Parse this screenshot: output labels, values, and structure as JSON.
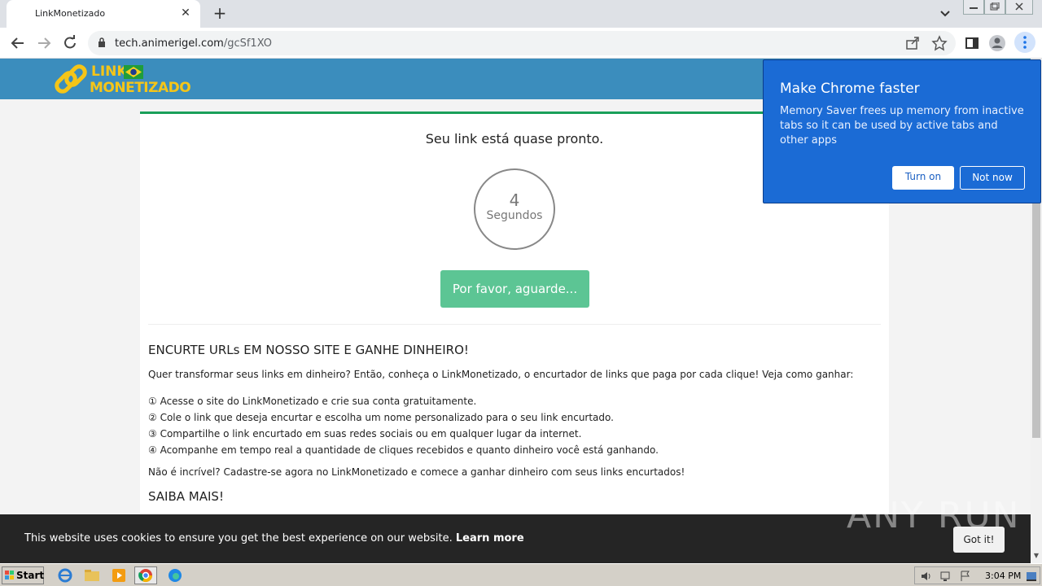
{
  "browser": {
    "tab_title": "LinkMonetizado",
    "url_host": "tech.animerigel.com",
    "url_path": "/gcSf1XO"
  },
  "site": {
    "logo_line1": "LINK",
    "logo_line2": "MONETIZADO",
    "ready_text": "Seu link está quase pronto.",
    "countdown_value": "4",
    "countdown_label": "Segundos",
    "wait_button": "Por favor, aguarde...",
    "heading_earn": "ENCURTE URLs EM NOSSO SITE E GANHE DINHEIRO!",
    "intro": "Quer transformar seus links em dinheiro? Então, conheça o LinkMonetizado, o encurtador de links que paga por cada clique! Veja como ganhar:",
    "steps": [
      "① Acesse o site do LinkMonetizado e crie sua conta gratuitamente.",
      "② Cole o link que deseja encurtar e escolha um nome personalizado para o seu link encurtado.",
      "③ Compartilhe o link encurtado em suas redes sociais ou em qualquer lugar da internet.",
      "④ Acompanhe em tempo real a quantidade de cliques recebidos e quanto dinheiro você está ganhando."
    ],
    "outro": "Não é incrível? Cadastre-se agora no LinkMonetizado e comece a ganhar dinheiro com seus links encurtados!",
    "heading_more": "SAIBA MAIS!"
  },
  "cookie_bar": {
    "text": "This website uses cookies to ensure you get the best experience on our website.",
    "link": "Learn more",
    "button": "Got it!"
  },
  "chrome_bubble": {
    "title": "Make Chrome faster",
    "body": "Memory Saver frees up memory from inactive tabs so it can be used by active tabs and other apps",
    "turn_on": "Turn on",
    "not_now": "Not now"
  },
  "watermark": "ANY RUN",
  "taskbar": {
    "start": "Start",
    "clock": "3:04 PM"
  },
  "colors": {
    "header_blue": "#3b8dbd",
    "card_accent": "#1aa05a",
    "wait_button": "#5cc594",
    "bubble": "#1b6bd5"
  }
}
